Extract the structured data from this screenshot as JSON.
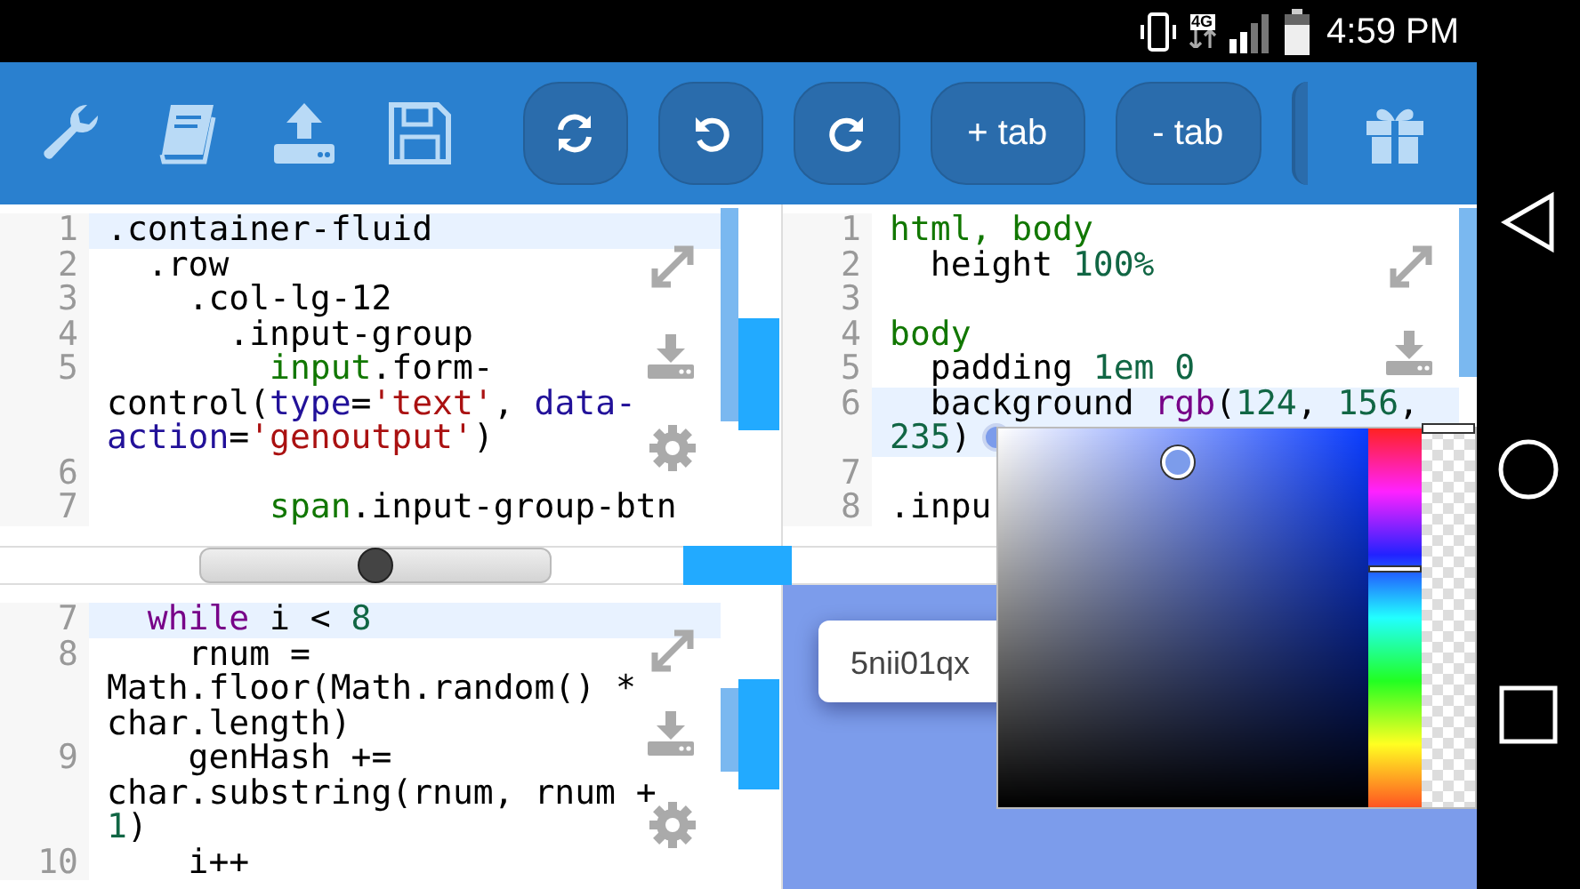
{
  "status_bar": {
    "network": "4G",
    "time": "4:59 PM"
  },
  "toolbar": {
    "buttons": [
      {
        "label": "+ tab"
      },
      {
        "label": "- tab"
      }
    ]
  },
  "editors": [
    {
      "lines": [
        {
          "number": "1",
          "current": true,
          "rows": [
            {
              "spans": [
                {
                  "kind": "plain",
                  "text": ".container-fluid"
                }
              ]
            }
          ]
        },
        {
          "number": "2",
          "current": false,
          "rows": [
            {
              "spans": [
                {
                  "kind": "plain",
                  "text": "  .row"
                }
              ]
            }
          ]
        },
        {
          "number": "3",
          "current": false,
          "rows": [
            {
              "spans": [
                {
                  "kind": "plain",
                  "text": "    .col-lg-12"
                }
              ]
            }
          ]
        },
        {
          "number": "4",
          "current": false,
          "rows": [
            {
              "spans": [
                {
                  "kind": "plain",
                  "text": "      .input-group"
                }
              ]
            }
          ]
        },
        {
          "number": "5",
          "current": false,
          "rows": [
            {
              "spans": [
                {
                  "kind": "tag",
                  "text": "        input"
                },
                {
                  "kind": "plain",
                  "text": ".form-"
                }
              ]
            },
            {
              "spans": [
                {
                  "kind": "plain",
                  "text": "control("
                },
                {
                  "kind": "attr",
                  "text": "type"
                },
                {
                  "kind": "plain",
                  "text": "="
                },
                {
                  "kind": "string",
                  "text": "'text'"
                },
                {
                  "kind": "plain",
                  "text": ", "
                },
                {
                  "kind": "attr",
                  "text": "data-"
                }
              ]
            },
            {
              "spans": [
                {
                  "kind": "attr",
                  "text": "action"
                },
                {
                  "kind": "plain",
                  "text": "="
                },
                {
                  "kind": "string",
                  "text": "'genoutput'"
                },
                {
                  "kind": "plain",
                  "text": ")"
                }
              ]
            }
          ]
        },
        {
          "number": "6",
          "current": false
        },
        {
          "number": "7",
          "current": false,
          "rows": [
            {
              "spans": [
                {
                  "kind": "tag",
                  "text": "        span"
                },
                {
                  "kind": "plain",
                  "text": ".input-group-btn"
                }
              ]
            }
          ]
        }
      ]
    },
    {
      "lines": [
        {
          "number": "1",
          "current": false,
          "rows": [
            {
              "spans": [
                {
                  "kind": "tag",
                  "text": "html, body"
                }
              ]
            }
          ]
        },
        {
          "number": "2",
          "current": false,
          "rows": [
            {
              "spans": [
                {
                  "kind": "plain",
                  "text": "  height "
                },
                {
                  "kind": "number",
                  "text": "100%"
                }
              ]
            }
          ]
        },
        {
          "number": "3",
          "current": false
        },
        {
          "number": "4",
          "current": false,
          "rows": [
            {
              "spans": [
                {
                  "kind": "tag",
                  "text": "body"
                }
              ]
            }
          ]
        },
        {
          "number": "5",
          "current": false,
          "rows": [
            {
              "spans": [
                {
                  "kind": "plain",
                  "text": "  padding "
                },
                {
                  "kind": "number",
                  "text": "1em 0"
                }
              ]
            }
          ]
        },
        {
          "number": "6",
          "current": true,
          "rows": [
            {
              "spans": [
                {
                  "kind": "plain",
                  "text": "  background "
                },
                {
                  "kind": "builtin",
                  "text": "rgb"
                },
                {
                  "kind": "plain",
                  "text": "("
                },
                {
                  "kind": "number",
                  "text": "124"
                },
                {
                  "kind": "plain",
                  "text": ", "
                },
                {
                  "kind": "number",
                  "text": "156"
                },
                {
                  "kind": "plain",
                  "text": ","
                }
              ]
            },
            {
              "spans": [
                {
                  "kind": "number",
                  "text": "235"
                },
                {
                  "kind": "plain",
                  "text": ")"
                },
                {
                  "kind": "swatch"
                }
              ]
            }
          ]
        },
        {
          "number": "7",
          "current": false
        },
        {
          "number": "8",
          "current": false,
          "rows": [
            {
              "spans": [
                {
                  "kind": "plain",
                  "text": ".inpu"
                }
              ]
            }
          ]
        }
      ]
    },
    {
      "lines": [
        {
          "number": "7",
          "current": true,
          "rows": [
            {
              "spans": [
                {
                  "kind": "keyword",
                  "text": "  while"
                },
                {
                  "kind": "plain",
                  "text": " i < "
                },
                {
                  "kind": "number",
                  "text": "8"
                }
              ]
            }
          ]
        },
        {
          "number": "8",
          "current": false,
          "rows": [
            {
              "spans": [
                {
                  "kind": "plain",
                  "text": "    rnum ="
                }
              ]
            },
            {
              "spans": [
                {
                  "kind": "plain",
                  "text": "Math.floor(Math.random() *"
                }
              ]
            },
            {
              "spans": [
                {
                  "kind": "plain",
                  "text": "char.length)"
                }
              ]
            }
          ]
        },
        {
          "number": "9",
          "current": false,
          "rows": [
            {
              "spans": [
                {
                  "kind": "plain",
                  "text": "    genHash +="
                }
              ]
            },
            {
              "spans": [
                {
                  "kind": "plain",
                  "text": "char.substring(rnum, rnum +"
                }
              ]
            },
            {
              "spans": [
                {
                  "kind": "number",
                  "text": "1"
                },
                {
                  "kind": "plain",
                  "text": ")"
                }
              ]
            }
          ]
        },
        {
          "number": "10",
          "current": false,
          "rows": [
            {
              "spans": [
                {
                  "kind": "plain",
                  "text": "    i++"
                }
              ]
            }
          ]
        }
      ]
    }
  ],
  "splitter": {
    "level": 0.5
  },
  "preview": {
    "output": "5nii01qx"
  },
  "color_picker": {
    "hue": {
      "level": 0.63
    },
    "alpha": {
      "level": 1
    }
  }
}
